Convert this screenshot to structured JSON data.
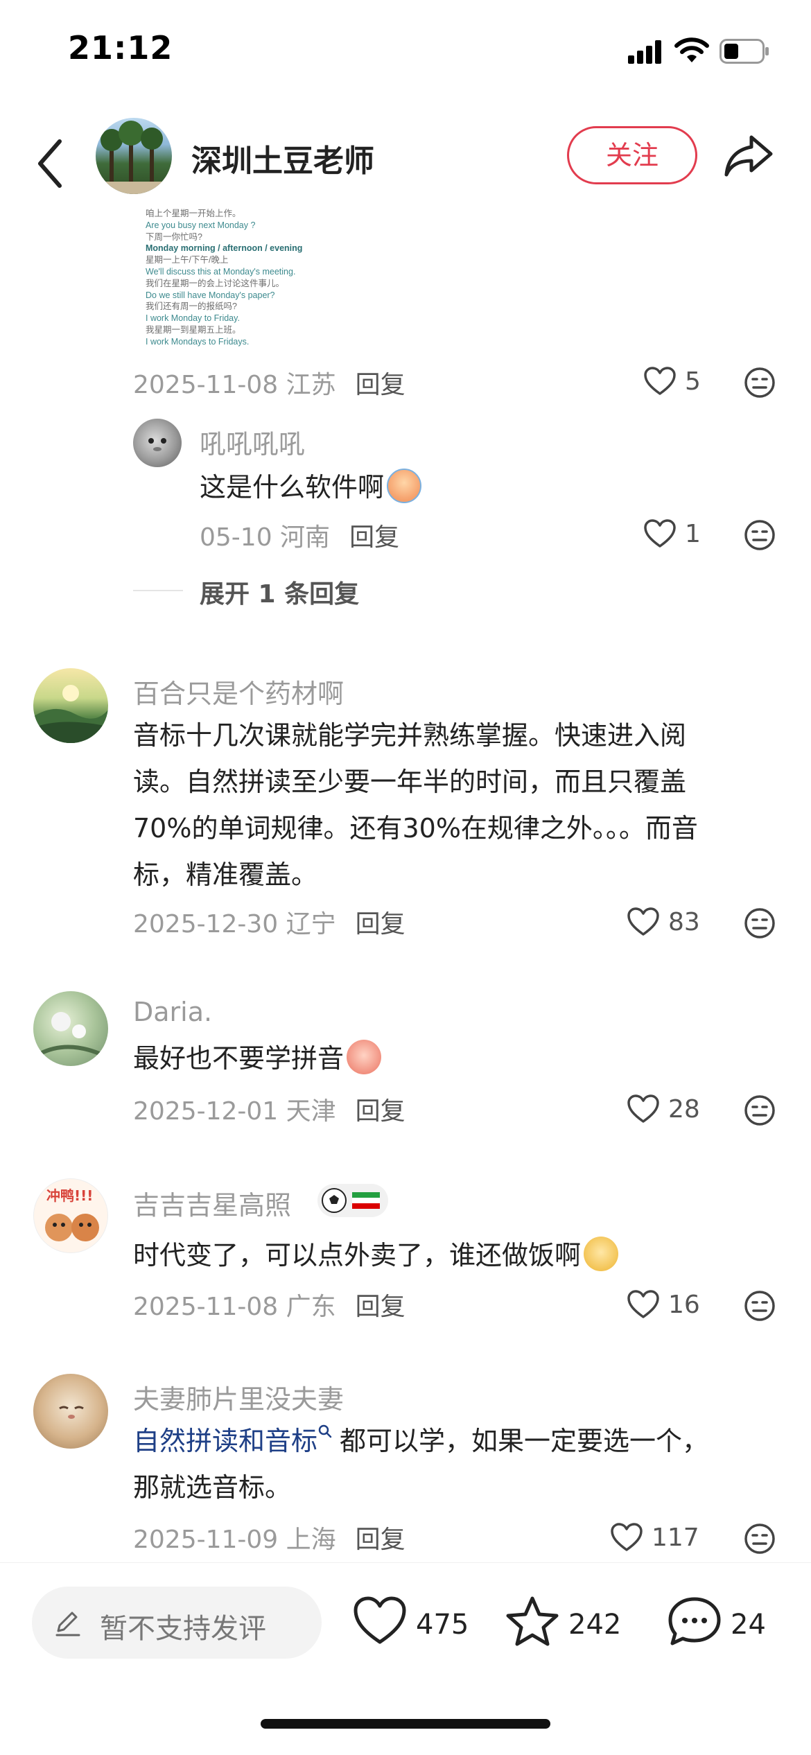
{
  "status_bar": {
    "time": "21:12"
  },
  "header": {
    "name": "深圳土豆老师",
    "follow_label": "关注"
  },
  "snippet_lines": [
    {
      "text": "咱上个星期一开始上作。",
      "style": "zh"
    },
    {
      "text": "Are you busy next Monday ?",
      "style": "en"
    },
    {
      "text": "下周一你忙吗?",
      "style": "zh"
    },
    {
      "text": "Monday morning / afternoon / evening",
      "style": "emph"
    },
    {
      "text": "星期一上午/下午/晚上",
      "style": "zh"
    },
    {
      "text": "We'll discuss this at Monday's meeting.",
      "style": "en"
    },
    {
      "text": "我们在星期一的会上讨论这件事儿。",
      "style": "zh"
    },
    {
      "text": "Do we still have Monday's paper?",
      "style": "en"
    },
    {
      "text": "我们还有周一的报纸吗?",
      "style": "zh"
    },
    {
      "text": "I work Monday to Friday.",
      "style": "en"
    },
    {
      "text": "我星期一到星期五上班。",
      "style": "zh"
    },
    {
      "text": "I work Mondays to Fridays.",
      "style": "en"
    }
  ],
  "top_comment": {
    "meta": "2025-11-08 江苏",
    "reply_label": "回复",
    "likes": "5"
  },
  "sub_reply": {
    "author": "吼吼吼吼",
    "text": "这是什么软件啊",
    "meta": "05-10 河南",
    "reply_label": "回复",
    "likes": "1"
  },
  "expand_label": "展开 1 条回复",
  "comments": [
    {
      "author": "百合只是个药材啊",
      "lines": [
        "音标十几次课就能学完并熟练掌握。快速进入阅",
        "读。自然拼读至少要一年半的时间，而且只覆盖",
        "70%的单词规律。还有30%在规律之外。。。而音",
        "标，精准覆盖。"
      ],
      "meta": "2025-12-30 辽宁",
      "reply_label": "回复",
      "likes": "83"
    },
    {
      "author": "Daria.",
      "text": "最好也不要学拼音",
      "meta": "2025-12-01 天津",
      "reply_label": "回复",
      "likes": "28"
    },
    {
      "author": "吉吉吉星高照",
      "avatar_text": "冲鸭!!!",
      "text": "时代变了，可以点外卖了，谁还做饭啊",
      "meta": "2025-11-08 广东",
      "reply_label": "回复",
      "likes": "16"
    },
    {
      "author": "夫妻肺片里没夫妻",
      "link_text": "自然拼读和音标",
      "text_rest": "都可以学，如果一定要选一个，",
      "text_line2": "那就选音标。",
      "meta": "2025-11-09 上海",
      "reply_label": "回复",
      "likes": "117"
    }
  ],
  "bottom_bar": {
    "input_placeholder": "暂不支持发评",
    "likes": "475",
    "stars": "242",
    "comments": "24"
  },
  "colors": {
    "accent": "#e23c4e",
    "link": "#1e3f86",
    "meta_gray": "#9a9a9a"
  }
}
